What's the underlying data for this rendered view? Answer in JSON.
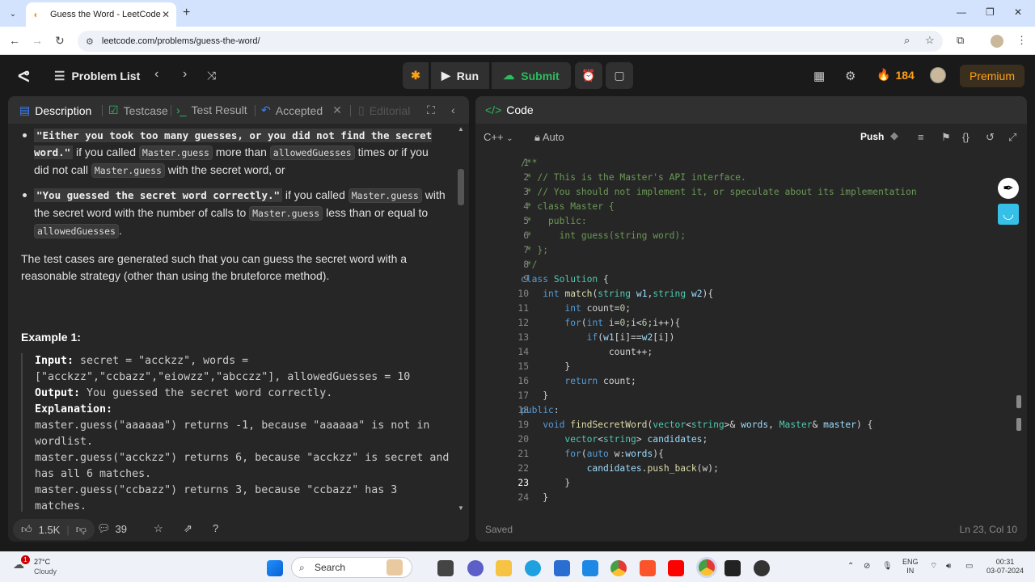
{
  "browser": {
    "tab_title": "Guess the Word - LeetCode",
    "url": "leetcode.com/problems/guess-the-word/"
  },
  "topbar": {
    "problem_list": "Problem List",
    "run": "Run",
    "submit": "Submit",
    "streak": "184",
    "premium": "Premium"
  },
  "left_tabs": {
    "description": "Description",
    "testcase": "Testcase",
    "test_result": "Test Result",
    "accepted": "Accepted",
    "editorial": "Editorial"
  },
  "description": {
    "b1_quote": "\"Either you took too many guesses, or you did not find the secret word.\"",
    "b1_t1": " if you called ",
    "b1_c1": "Master.guess",
    "b1_t2": " more than ",
    "b1_c2": "allowedGuesses",
    "b1_t3": " times or if you did not call ",
    "b1_c3": "Master.guess",
    "b1_t4": " with the secret word, or",
    "b2_quote": "\"You guessed the secret word correctly.\"",
    "b2_t1": " if you called ",
    "b2_c1": "Master.guess",
    "b2_t2": " with the secret word with the number of calls to ",
    "b2_c2": "Master.guess",
    "b2_t3": " less than or equal to ",
    "b2_c3": "allowedGuesses",
    "b2_t4": ".",
    "para": "The test cases are generated such that you can guess the secret word with a reasonable strategy (other than using the bruteforce method).",
    "example_title": "Example 1:",
    "input_label": "Input:",
    "input_val": " secret = \"acckzz\", words = [\"acckzz\",\"ccbazz\",\"eiowzz\",\"abcczz\"], allowedGuesses = 10",
    "output_label": "Output:",
    "output_val": " You guessed the secret word correctly.",
    "explanation_label": "Explanation:",
    "exp1": "master.guess(\"aaaaaa\") returns -1, because \"aaaaaa\" is not in wordlist.",
    "exp2": "master.guess(\"acckzz\") returns 6, because \"acckzz\" is secret and has all 6 matches.",
    "exp3": "master.guess(\"ccbazz\") returns 3, because \"ccbazz\" has 3 matches."
  },
  "left_footer": {
    "likes": "1.5K",
    "comments": "39"
  },
  "code_panel": {
    "title": "Code",
    "language": "C++",
    "mode": "Auto",
    "push": "Push",
    "saved": "Saved",
    "cursor": "Ln 23, Col 10"
  },
  "code_lines": [
    "/**",
    " * // This is the Master's API interface.",
    " * // You should not implement it, or speculate about its implementation",
    " * class Master {",
    " *   public:",
    " *     int guess(string word);",
    " * };",
    " */",
    "class Solution {",
    "    int match(string w1,string w2){",
    "        int count=0;",
    "        for(int i=0;i<6;i++){",
    "            if(w1[i]==w2[i])",
    "                count++;",
    "        }",
    "        return count;",
    "    }",
    "public:",
    "    void findSecretWord(vector<string>& words, Master& master) {",
    "        vector<string> candidates;",
    "        for(auto w:words){",
    "            candidates.push_back(w);",
    "        }",
    "    }"
  ],
  "taskbar": {
    "weather_temp": "27°C",
    "weather_desc": "Cloudy",
    "weather_badge": "1",
    "search": "Search",
    "lang1": "ENG",
    "lang2": "IN",
    "time": "00:31",
    "date": "03-07-2024"
  }
}
